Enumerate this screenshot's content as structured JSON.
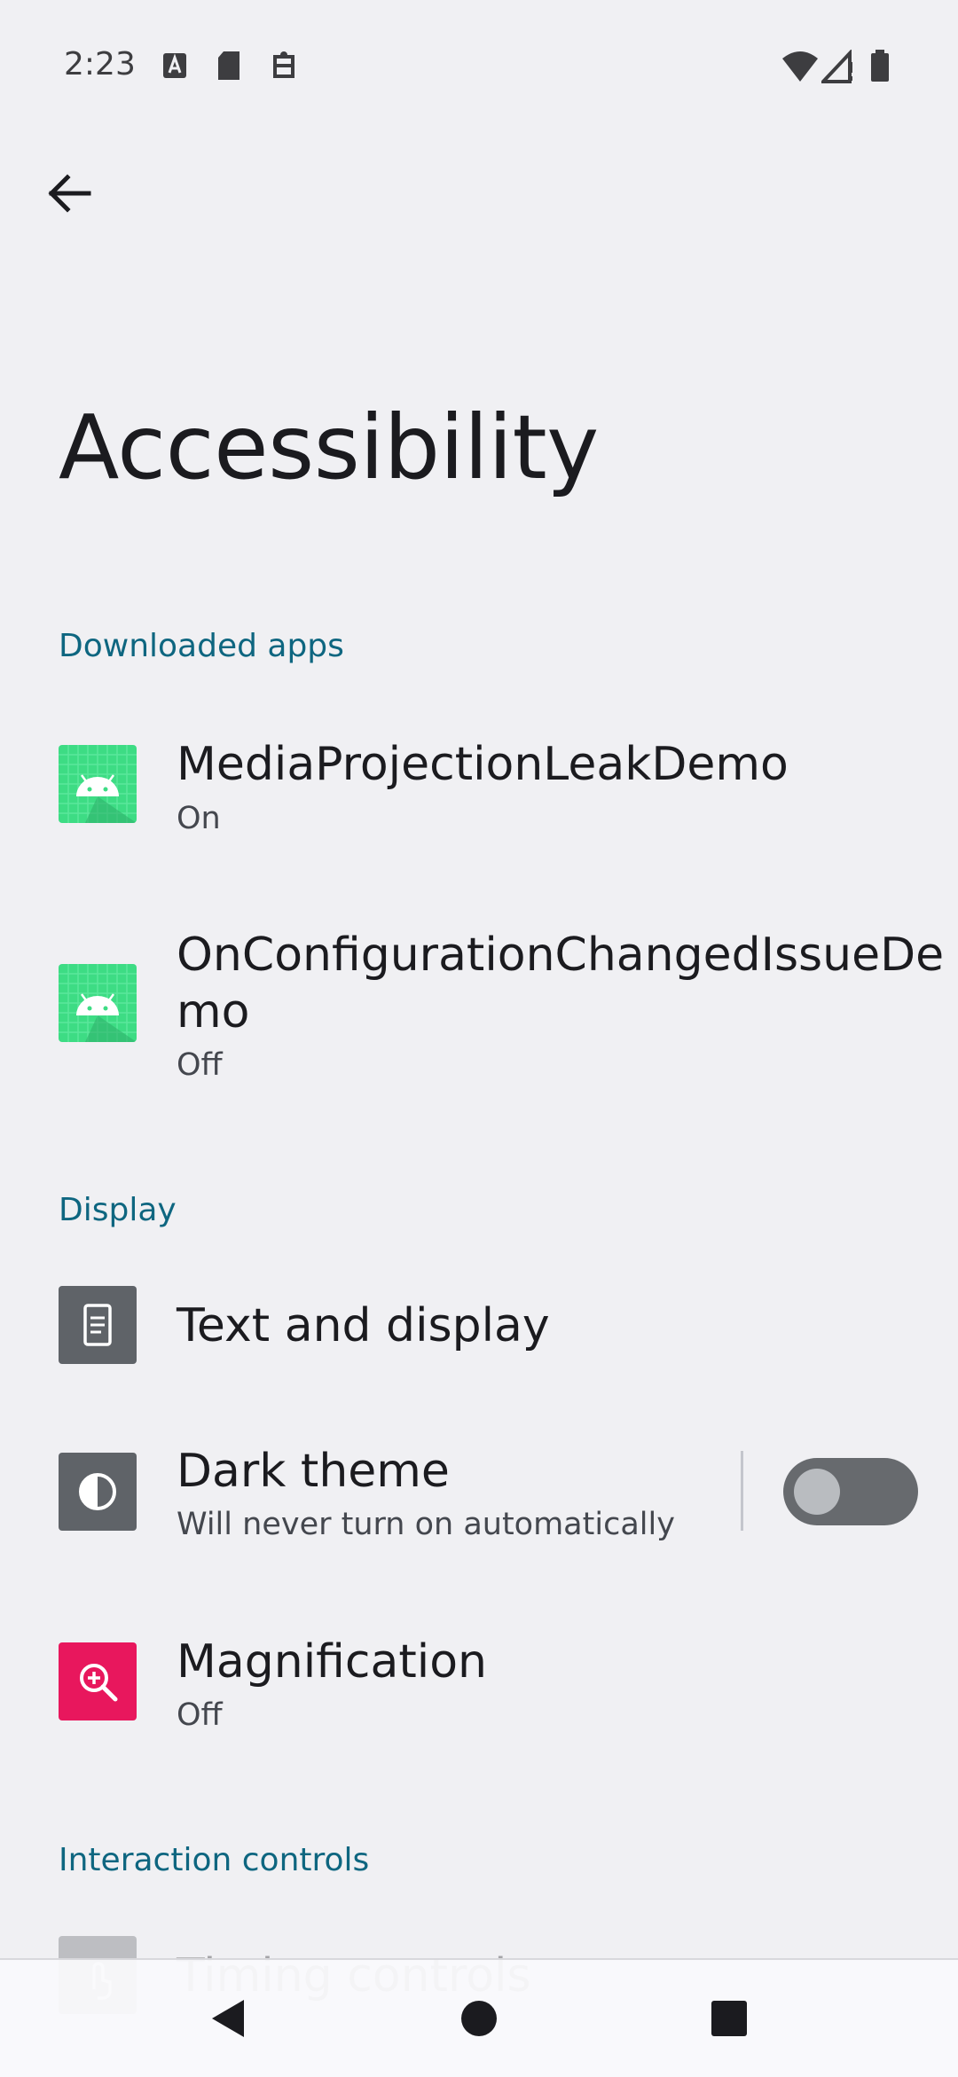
{
  "status_bar": {
    "time": "2:23",
    "left_icons": [
      "text-a-icon",
      "sd-card-icon",
      "accessibility-badge-icon"
    ],
    "right_icons": [
      "wifi-icon",
      "cell-signal-icon",
      "battery-icon"
    ]
  },
  "page": {
    "title": "Accessibility"
  },
  "sections": {
    "downloaded_apps": {
      "header": "Downloaded apps",
      "items": [
        {
          "title": "MediaProjectionLeakDemo",
          "subtitle": "On",
          "icon": "android-app-icon"
        },
        {
          "title_line1": "OnConfigurationChangedIssueDe",
          "title_line2": "mo",
          "subtitle": "Off",
          "icon": "android-app-icon"
        }
      ]
    },
    "display": {
      "header": "Display",
      "items": [
        {
          "title": "Text and display",
          "icon": "text-display-icon"
        },
        {
          "title": "Dark theme",
          "subtitle": "Will never turn on automatically",
          "icon": "dark-theme-icon",
          "toggle_on": false
        },
        {
          "title": "Magnification",
          "subtitle": "Off",
          "icon": "magnify-icon"
        }
      ]
    },
    "interaction_controls": {
      "header": "Interaction controls",
      "items": [
        {
          "title": "Timing controls",
          "icon": "touch-icon"
        }
      ]
    }
  },
  "colors": {
    "background": "#f0f0f3",
    "section_header": "#0e6680",
    "android_green": "#3ddc84",
    "magnification_pink": "#e8175d",
    "icon_gray": "#5f6368"
  },
  "nav_bar": {
    "buttons": [
      "back-triangle-icon",
      "home-circle-icon",
      "recents-square-icon"
    ]
  }
}
